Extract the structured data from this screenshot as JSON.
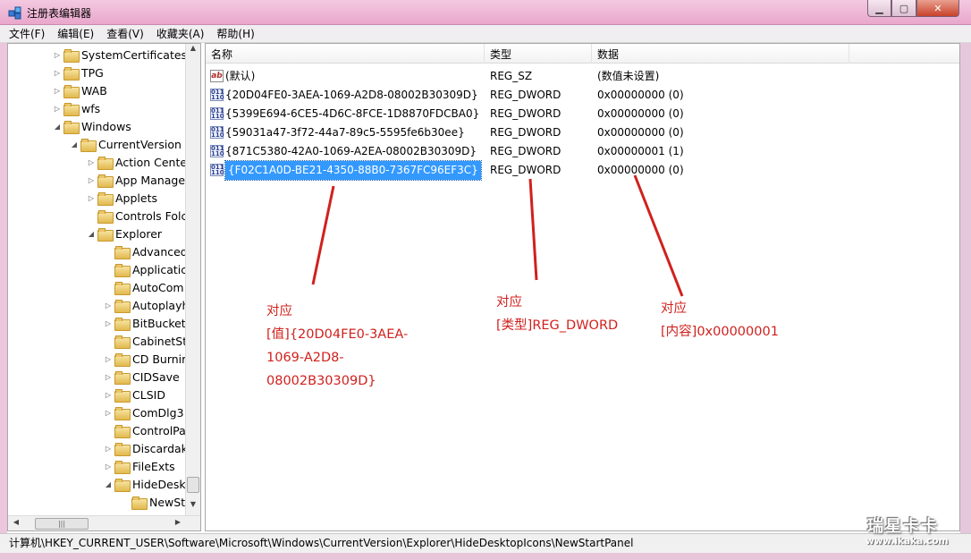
{
  "window": {
    "title": "注册表编辑器",
    "controls": {
      "minimize": "▁",
      "maximize": "▢",
      "close": "✕"
    }
  },
  "menu": [
    "文件(F)",
    "编辑(E)",
    "查看(V)",
    "收藏夹(A)",
    "帮助(H)"
  ],
  "tree": [
    {
      "label": "SystemCertificates",
      "expand": "▷"
    },
    {
      "label": "TPG",
      "expand": "▷"
    },
    {
      "label": "WAB",
      "expand": "▷"
    },
    {
      "label": "wfs",
      "expand": "▷"
    },
    {
      "label": "Windows",
      "expand": "◢"
    },
    {
      "label": "CurrentVersion",
      "expand": "◢"
    },
    {
      "label": "Action Cente",
      "expand": "▷"
    },
    {
      "label": "App Manage",
      "expand": "▷"
    },
    {
      "label": "Applets",
      "expand": "▷"
    },
    {
      "label": "Controls Folc",
      "expand": ""
    },
    {
      "label": "Explorer",
      "expand": "◢"
    },
    {
      "label": "Advanced",
      "expand": ""
    },
    {
      "label": "Applicatic",
      "expand": ""
    },
    {
      "label": "AutoCom",
      "expand": ""
    },
    {
      "label": "Autoplayh",
      "expand": "▷"
    },
    {
      "label": "BitBucket",
      "expand": "▷"
    },
    {
      "label": "CabinetSt",
      "expand": ""
    },
    {
      "label": "CD Burnir",
      "expand": "▷"
    },
    {
      "label": "CIDSave",
      "expand": "▷"
    },
    {
      "label": "CLSID",
      "expand": "▷"
    },
    {
      "label": "ComDlg3",
      "expand": "▷"
    },
    {
      "label": "ControlPa",
      "expand": ""
    },
    {
      "label": "Discardak",
      "expand": "▷"
    },
    {
      "label": "FileExts",
      "expand": "▷"
    },
    {
      "label": "HideDesk",
      "expand": "◢"
    },
    {
      "label": "NewSt",
      "expand": ""
    }
  ],
  "list": {
    "columns": [
      "名称",
      "类型",
      "数据"
    ],
    "rows": [
      {
        "name": "(默认)",
        "type": "REG_SZ",
        "data": "(数值未设置)",
        "icon": "ab"
      },
      {
        "name": "{20D04FE0-3AEA-1069-A2D8-08002B30309D}",
        "type": "REG_DWORD",
        "data": "0x00000000 (0)",
        "icon": "011 110"
      },
      {
        "name": "{5399E694-6CE5-4D6C-8FCE-1D8870FDCBA0}",
        "type": "REG_DWORD",
        "data": "0x00000000 (0)",
        "icon": "011 110"
      },
      {
        "name": "{59031a47-3f72-44a7-89c5-5595fe6b30ee}",
        "type": "REG_DWORD",
        "data": "0x00000000 (0)",
        "icon": "011 110"
      },
      {
        "name": "{871C5380-42A0-1069-A2EA-08002B30309D}",
        "type": "REG_DWORD",
        "data": "0x00000001 (1)",
        "icon": "011 110"
      },
      {
        "name": "{F02C1A0D-BE21-4350-88B0-7367FC96EF3C}",
        "type": "REG_DWORD",
        "data": "0x00000000 (0)",
        "icon": "011 110"
      }
    ]
  },
  "annotations": {
    "name": [
      "对应",
      "[值]{20D04FE0-3AEA-",
      "1069-A2D8-",
      "08002B30309D}"
    ],
    "type": [
      "对应",
      "[类型]REG_DWORD"
    ],
    "data": [
      "对应",
      "[内容]0x00000001"
    ]
  },
  "status": "计算机\\HKEY_CURRENT_USER\\Software\\Microsoft\\Windows\\CurrentVersion\\Explorer\\HideDesktopIcons\\NewStartPanel",
  "watermark": {
    "cn": "瑞星卡卡",
    "url": "www.ikaka.com"
  },
  "colors": {
    "annotation": "#d0211d",
    "selection": "#3399ff",
    "titlebar": "#e9a7cc"
  }
}
